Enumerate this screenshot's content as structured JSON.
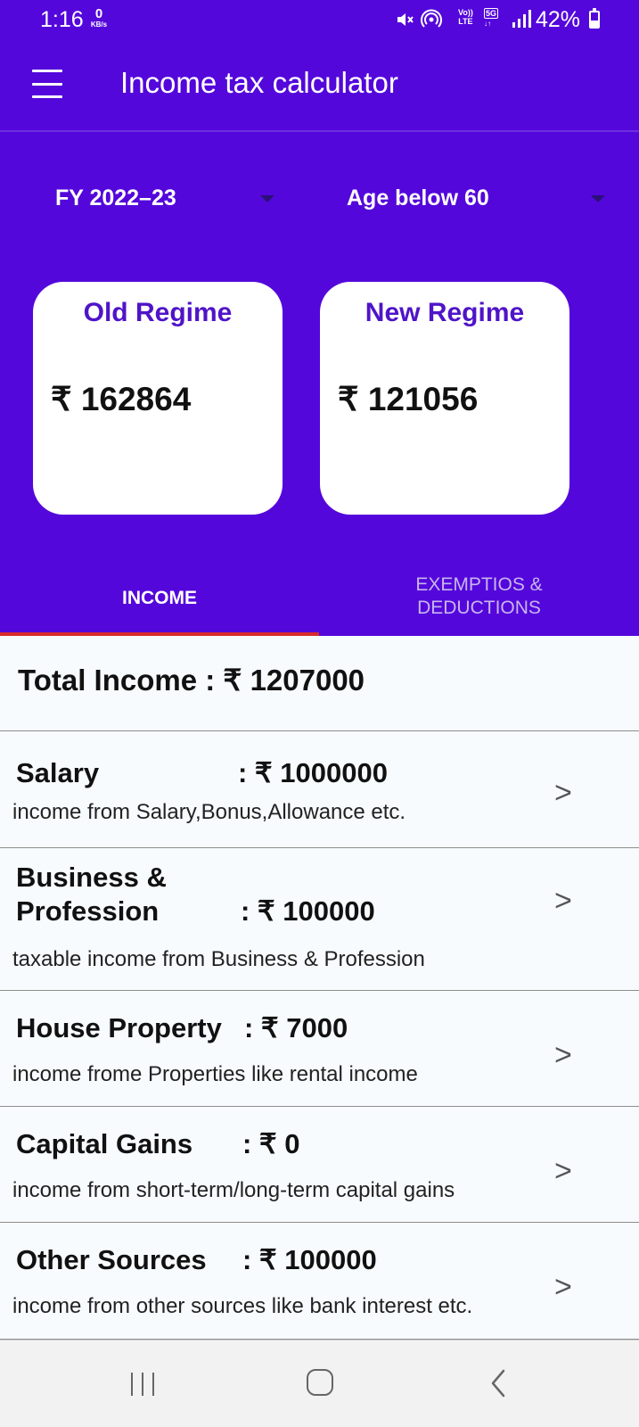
{
  "status_bar": {
    "time": "1:16",
    "network_speed_value": "0",
    "network_speed_unit": "KB/s",
    "volte_label_top": "Vo))",
    "volte_label_bottom": "LTE",
    "network_type": "5G",
    "battery_percent": "42%",
    "battery_level": 0.42
  },
  "app_bar": {
    "title": "Income tax calculator"
  },
  "filters": {
    "financial_year": "FY 2022–23",
    "age_group": "Age below 60"
  },
  "regimes": {
    "old": {
      "title": "Old Regime",
      "amount": "₹ 162864"
    },
    "new": {
      "title": "New Regime",
      "amount": "₹ 121056"
    }
  },
  "tabs": {
    "income": "INCOME",
    "exemptions_line1": "EXEMPTIOS &",
    "exemptions_line2": "DEDUCTIONS"
  },
  "total_income": {
    "label": "Total Income  : ₹ 1207000"
  },
  "income_rows": [
    {
      "name": "Salary",
      "amount": ": ₹ 1000000",
      "description": "income from Salary,Bonus,Allowance etc.",
      "chevron": ">"
    },
    {
      "name_line1": "Business &",
      "name_line2": "Profession",
      "amount": ": ₹ 100000",
      "description": "taxable income from Business & Profession",
      "chevron": ">"
    },
    {
      "name": "House Property",
      "amount": ": ₹ 7000",
      "description": "income frome Properties like rental income",
      "chevron": ">"
    },
    {
      "name": "Capital Gains",
      "amount": ": ₹ 0",
      "description": "income from short-term/long-term capital gains",
      "chevron": ">"
    },
    {
      "name": "Other Sources",
      "amount": ": ₹ 100000",
      "description": "income from other sources like bank interest etc.",
      "chevron": ">"
    }
  ],
  "colors": {
    "primary": "#5407db",
    "card_title": "#4f14c8",
    "tab_indicator": "#d72b2b",
    "content_background": "#f7fbfd"
  },
  "icons": [
    "menu-icon",
    "mute-icon",
    "hotspot-icon",
    "signal-icon",
    "battery-icon",
    "dropdown-arrow-icon",
    "chevron-right-icon",
    "recents-icon",
    "home-icon",
    "back-icon"
  ]
}
